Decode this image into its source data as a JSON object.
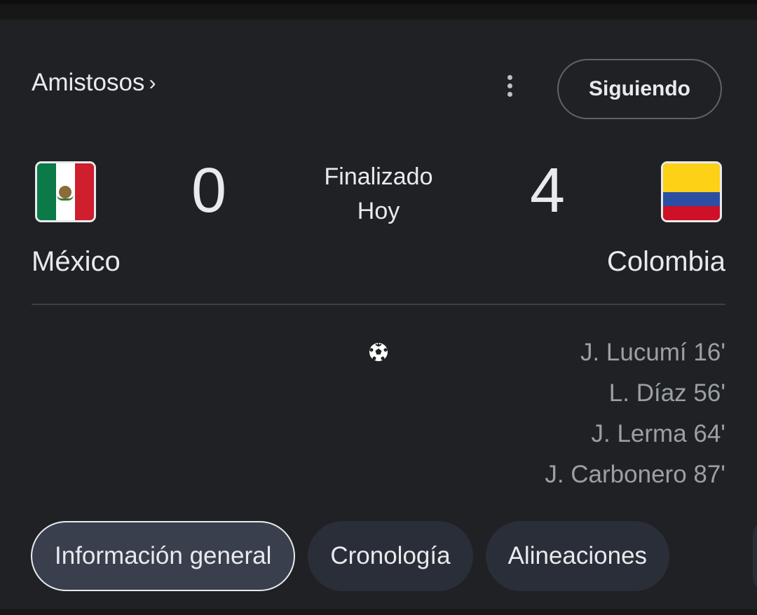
{
  "header": {
    "competition": "Amistosos",
    "competition_chevron": "›",
    "follow_label": "Siguiendo"
  },
  "match": {
    "home": {
      "name": "México",
      "score": "0",
      "flag": "mexico-flag-icon"
    },
    "away": {
      "name": "Colombia",
      "score": "4",
      "flag": "colombia-flag-icon"
    },
    "status": "Finalizado",
    "date": "Hoy"
  },
  "goals": {
    "icon": "soccer-ball-icon",
    "away_scorers": [
      "J. Lucumí 16'",
      "L. Díaz 56'",
      "J. Lerma 64'",
      "J. Carbonero 87'"
    ]
  },
  "tabs": [
    {
      "label": "Información general",
      "active": true
    },
    {
      "label": "Cronología",
      "active": false
    },
    {
      "label": "Alineaciones",
      "active": false
    }
  ],
  "colors": {
    "background": "#202124",
    "text": "#e8eaed",
    "muted": "#9aa0a6",
    "tab_bg": "#2a2e38",
    "tab_active_bg": "#3a3f4e"
  }
}
